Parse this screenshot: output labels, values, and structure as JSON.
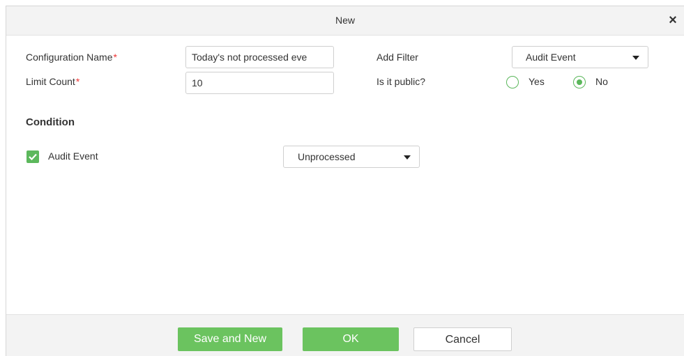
{
  "dialog": {
    "title": "New",
    "close_glyph": "×"
  },
  "form": {
    "config_name_label": "Configuration Name",
    "config_name_value": "Today's not processed eve",
    "limit_count_label": "Limit Count",
    "limit_count_value": "10",
    "required_mark": "*",
    "add_filter_label": "Add Filter",
    "add_filter_value": "Audit Event",
    "public_label": "Is it public?",
    "public_yes": "Yes",
    "public_no": "No",
    "public_selected": "No"
  },
  "condition": {
    "heading": "Condition",
    "item_label": "Audit Event",
    "item_checked": true,
    "item_value": "Unprocessed"
  },
  "footer": {
    "save_new_label": "Save and New",
    "ok_label": "OK",
    "cancel_label": "Cancel"
  },
  "colors": {
    "accent_green": "#6bc35f",
    "required_red": "#ee3333"
  },
  "icons": {
    "close": "close-icon",
    "dropdown": "chevron-down-icon",
    "check": "checkmark-icon"
  }
}
